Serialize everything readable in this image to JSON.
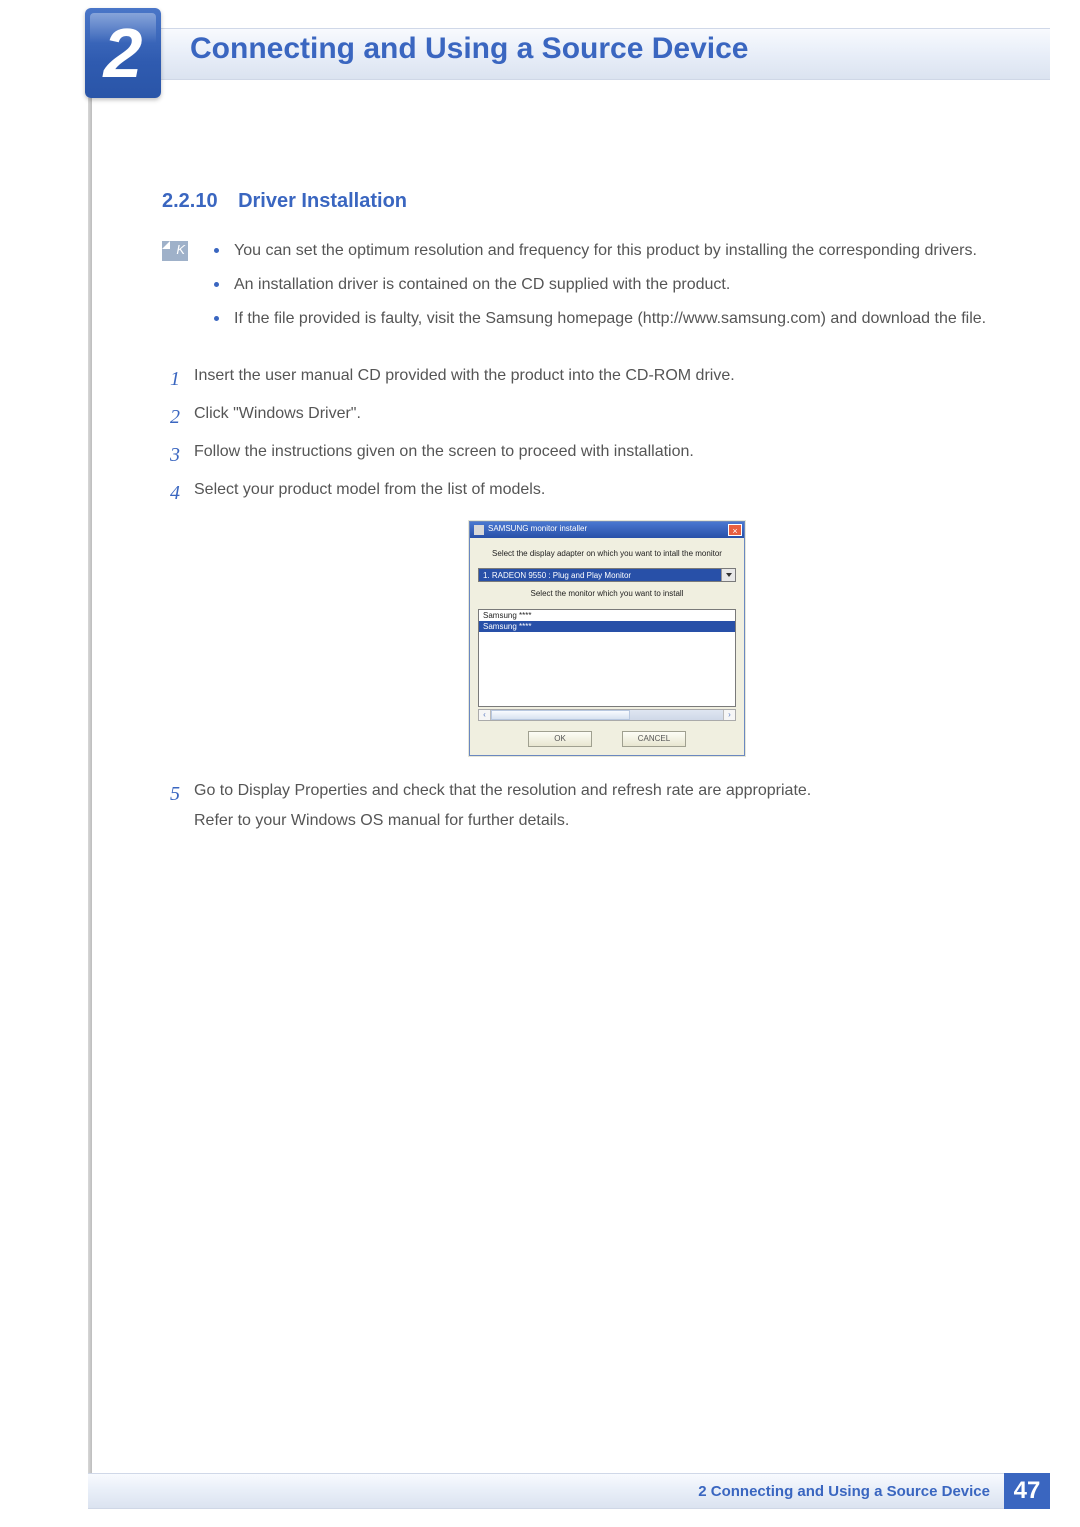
{
  "header": {
    "chapter_number": "2",
    "chapter_title": "Connecting and Using a Source Device"
  },
  "section": {
    "number": "2.2.10",
    "title": "Driver Installation"
  },
  "notes": [
    "You can set the optimum resolution and frequency for this product by installing the corresponding drivers.",
    "An installation driver is contained on the CD supplied with the product.",
    "If the file provided is faulty, visit the Samsung homepage (http://www.samsung.com) and download the file."
  ],
  "steps": {
    "1": "Insert the user manual CD provided with the product into the CD-ROM drive.",
    "2": "Click \"Windows Driver\".",
    "3": "Follow the instructions given on the screen to proceed with installation.",
    "4": "Select your product model from the list of models.",
    "5a": "Go to Display Properties and check that the resolution and refresh rate are appropriate.",
    "5b": "Refer to your Windows OS manual for further details."
  },
  "installer": {
    "window_title": "SAMSUNG monitor installer",
    "label_adapter": "Select the display adapter on which you want to intall the monitor",
    "combo_value": "1. RADEON 9550 : Plug and Play Monitor",
    "label_monitor": "Select the monitor which you want to install",
    "list_item_unselected": "Samsung ****",
    "list_item_selected": "Samsung ****",
    "btn_ok": "OK",
    "btn_cancel": "CANCEL"
  },
  "footer": {
    "text": "2 Connecting and Using a Source Device",
    "page": "47"
  }
}
